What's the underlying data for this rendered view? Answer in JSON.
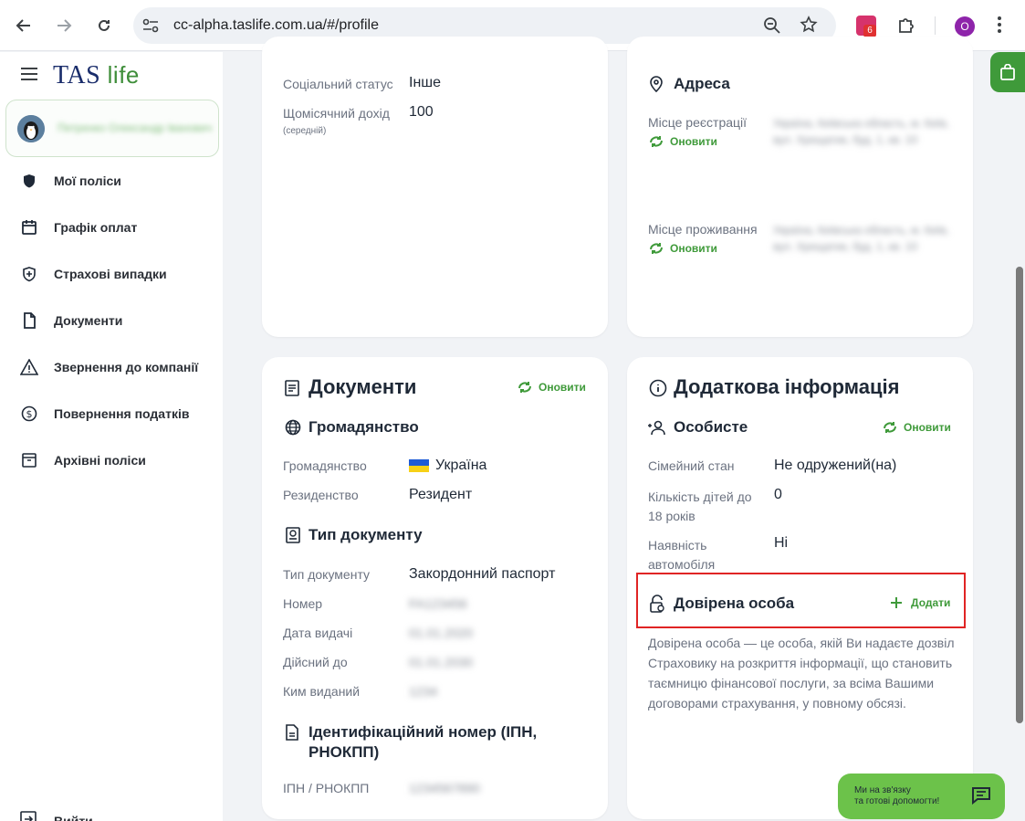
{
  "browser": {
    "url": "cc-alpha.taslife.com.ua/#/profile",
    "extension_badge": "6",
    "profile_initial": "O"
  },
  "brand": {
    "tas": "TAS",
    "life": "life"
  },
  "user": {
    "name": "Петренко Олександр Іванович"
  },
  "nav": {
    "items": [
      {
        "label": "Мої поліси",
        "icon": "shield-icon"
      },
      {
        "label": "Графік оплат",
        "icon": "calendar-icon"
      },
      {
        "label": "Страхові випадки",
        "icon": "shield-plus-icon"
      },
      {
        "label": "Документи",
        "icon": "document-icon"
      },
      {
        "label": "Звернення до компанії",
        "icon": "warning-icon"
      },
      {
        "label": "Повернення податків",
        "icon": "dollar-icon"
      },
      {
        "label": "Архівні поліси",
        "icon": "archive-icon"
      }
    ],
    "logout": "Вийти"
  },
  "social": {
    "status_label": "Соціальний статус",
    "status_value": "Інше",
    "income_label": "Щомісячний дохід",
    "income_hint": "(середній)",
    "income_value": "100"
  },
  "address": {
    "title": "Адреса",
    "registration_label": "Місце реєстрації",
    "residence_label": "Місце проживання",
    "refresh": "Оновити",
    "registration_value": "Україна, Київська область, м. Київ, вул. Хрещатик, буд. 1, кв. 10",
    "residence_value": "Україна, Київська область, м. Київ, вул. Хрещатик, буд. 1, кв. 10"
  },
  "documents": {
    "title": "Документи",
    "refresh": "Оновити",
    "citizenship_title": "Громадянство",
    "citizenship_label": "Громадянство",
    "citizenship_value": "Україна",
    "residency_label": "Резиденство",
    "residency_value": "Резидент",
    "doctype_title": "Тип документу",
    "doctype_label": "Тип документу",
    "doctype_value": "Закордонний паспорт",
    "number_label": "Номер",
    "number_value": "FA123456",
    "issue_date_label": "Дата видачі",
    "issue_date_value": "01.01.2020",
    "valid_until_label": "Дійсний до",
    "valid_until_value": "01.01.2030",
    "issued_by_label": "Ким виданий",
    "issued_by_value": "1234",
    "tax_title": "Ідентифікаційний номер (ІПН, РНОКПП)",
    "tax_label": "ІПН / РНОКПП",
    "tax_value": "1234567890"
  },
  "extra": {
    "title": "Додаткова інформація",
    "personal_title": "Особисте",
    "refresh": "Оновити",
    "marital_label": "Сімейний стан",
    "marital_value": "Не одружений(на)",
    "children_label": "Кількість дітей до 18 років",
    "children_value": "0",
    "car_label": "Наявність автомобіля",
    "car_value": "Ні",
    "trusted_title": "Довірена особа",
    "add": "Додати",
    "trusted_desc": "Довірена особа — це особа, якій Ви надаєте дозвіл Страховику на розкриття інформації, що становить таємницю фінансової послуги, за всіма Вашими договорами страхування, у повному обсязі."
  },
  "chat": {
    "line1": "Ми на зв'язку",
    "line2": "та готові допомогти!"
  },
  "colors": {
    "accent": "#3f9a3a",
    "brand": "#1a2d6b",
    "highlight": "#e02424"
  }
}
